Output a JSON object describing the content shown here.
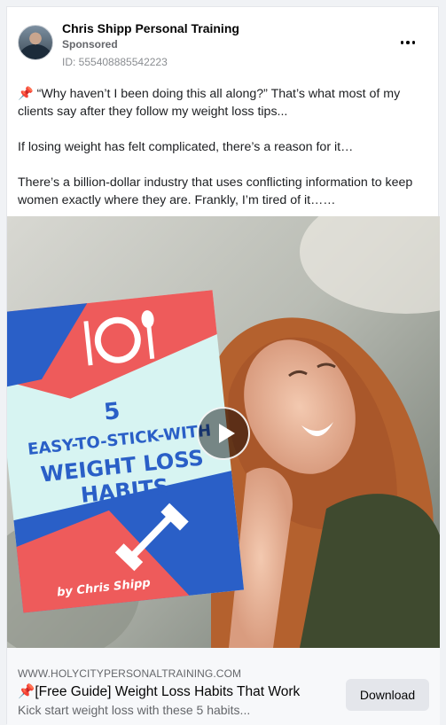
{
  "post": {
    "page_name": "Chris Shipp Personal Training",
    "sponsored_label": "Sponsored",
    "ad_id": "ID: 555408885542223",
    "body": [
      "“Why haven’t I been doing this all along?” That’s what most of my clients say after they follow my weight loss tips...",
      "If losing weight has felt complicated, there’s a reason for it…",
      "There’s a billion-dollar industry that uses conflicting information to keep women exactly where they are. Frankly, I’m tired of it……"
    ],
    "pin_emoji": "📌"
  },
  "media": {
    "book_line1": "5",
    "book_line2": "EASY-TO-STICK-WITH",
    "book_line3": "WEIGHT LOSS",
    "book_line4": "HABITS",
    "book_author": "by Chris Shipp",
    "icons": [
      "fork-knife-plate-icon",
      "dumbbell-icon",
      "play-icon"
    ]
  },
  "link": {
    "domain": "WWW.HOLYCITYPERSONALTRAINING.COM",
    "title": "[Free Guide] Weight Loss Habits That Work",
    "description": "Kick start weight loss with these 5 habits...",
    "cta": "Download"
  },
  "colors": {
    "accent_red": "#ee5b5b",
    "accent_blue": "#2a5fc7",
    "mint": "#d7f4f2"
  }
}
